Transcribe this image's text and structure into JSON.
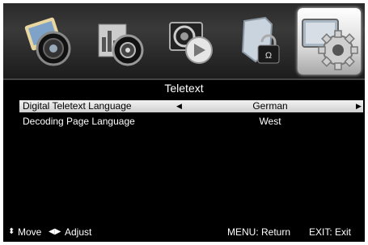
{
  "menu_icons": [
    {
      "name": "picture-icon"
    },
    {
      "name": "sound-icon"
    },
    {
      "name": "channel-icon"
    },
    {
      "name": "lock-icon"
    },
    {
      "name": "setup-gear-icon",
      "selected": true
    }
  ],
  "title": "Teletext",
  "rows": [
    {
      "label": "Digital Teletext Language",
      "value": "German",
      "left_arrow": "◀",
      "right_arrow": "▶"
    },
    {
      "label": "Decoding Page Language",
      "value": "West"
    }
  ],
  "footer": {
    "move_glyph": "⬍",
    "move_label": "Move",
    "adjust_glyph": "◀▶",
    "adjust_label": "Adjust",
    "menu_hint": "MENU: Return",
    "exit_hint": "EXIT: Exit"
  }
}
